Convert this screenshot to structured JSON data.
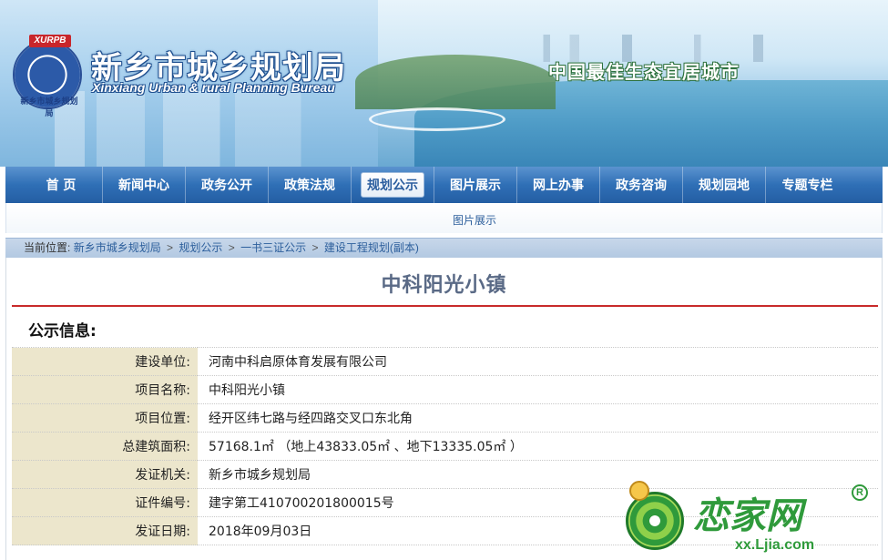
{
  "header": {
    "site_title": "新乡市城乡规划局",
    "site_subtitle": "Xinxiang Urban & rural Planning Bureau",
    "logo_tag": "XURPB",
    "logo_ring_text": "新乡市城乡规划局",
    "slogan": "中国最佳生态宜居城市"
  },
  "nav": {
    "items": [
      {
        "label": "首 页",
        "active": false
      },
      {
        "label": "新闻中心",
        "active": false
      },
      {
        "label": "政务公开",
        "active": false
      },
      {
        "label": "政策法规",
        "active": false
      },
      {
        "label": "规划公示",
        "active": true
      },
      {
        "label": "图片展示",
        "active": false
      },
      {
        "label": "网上办事",
        "active": false
      },
      {
        "label": "政务咨询",
        "active": false
      },
      {
        "label": "规划园地",
        "active": false
      },
      {
        "label": "专题专栏",
        "active": false
      }
    ],
    "sub_link": "图片展示"
  },
  "breadcrumb": {
    "prefix": "当前位置:",
    "items": [
      "新乡市城乡规划局",
      "规划公示",
      "一书三证公示",
      "建设工程规划(副本)"
    ],
    "separator": ">"
  },
  "content": {
    "page_title": "中科阳光小镇",
    "section_heading": "公示信息:",
    "rows": [
      {
        "label": "建设单位:",
        "value": "河南中科启原体育发展有限公司"
      },
      {
        "label": "项目名称:",
        "value": "中科阳光小镇"
      },
      {
        "label": "项目位置:",
        "value": "经开区纬七路与经四路交叉口东北角"
      },
      {
        "label": "总建筑面积:",
        "value": "57168.1㎡ （地上43833.05㎡ 、地下13335.05㎡ ）"
      },
      {
        "label": "发证机关:",
        "value": "新乡市城乡规划局"
      },
      {
        "label": "证件编号:",
        "value": "建字第工410700201800015号"
      },
      {
        "label": "发证日期:",
        "value": "2018年09月03日"
      }
    ]
  },
  "watermark": {
    "brand": "恋家网",
    "reg_mark": "R",
    "url": "xx.Ljia.com"
  },
  "colors": {
    "nav_blue": "#2f6fb6",
    "title_rule_red": "#c82a2a",
    "label_bg": "#ece6cc",
    "watermark_green": "#2f9a3b"
  }
}
